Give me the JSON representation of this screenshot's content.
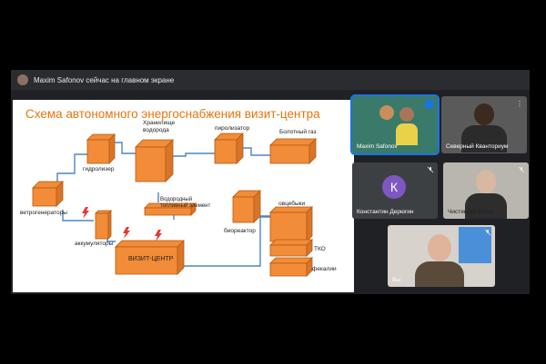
{
  "meet": {
    "presenter_banner": "Maxim Safonov сейчас на главном экране"
  },
  "slide": {
    "title": "Схема автономного энергоснабжения визит-центра",
    "labels": {
      "hydrogen_storage": "Хранилище\nводорода",
      "pyrolyzer": "пиролизатор",
      "swamp_gas": "Болотный газ",
      "hydrolyzer": "гидролизер",
      "wind_generators": "ветрогенераторы",
      "fuel_cell": "Водородный\nтопливный элемент",
      "sheep": "овцебыки",
      "accumulators": "аккумуляторы",
      "bioreactor": "биореактор",
      "visit_center": "ВИЗИТ-ЦЕНТР",
      "tko": "ТКО",
      "feces": "фекалии"
    },
    "colors": {
      "box": "#f28c38",
      "box_stroke": "#b35a10",
      "line": "#4a86c8",
      "title": "#e8750e",
      "lightning": "#e53935"
    }
  },
  "participants": [
    {
      "name": "Maxim Safonov",
      "speaking": true
    },
    {
      "name": "Северный Кванториум",
      "muted": false
    },
    {
      "name": "Константин Дерюгин",
      "initial": "К",
      "muted": true
    },
    {
      "name": "Чистякова Юлия",
      "muted": true
    },
    {
      "name": "Вы",
      "muted": true
    }
  ]
}
